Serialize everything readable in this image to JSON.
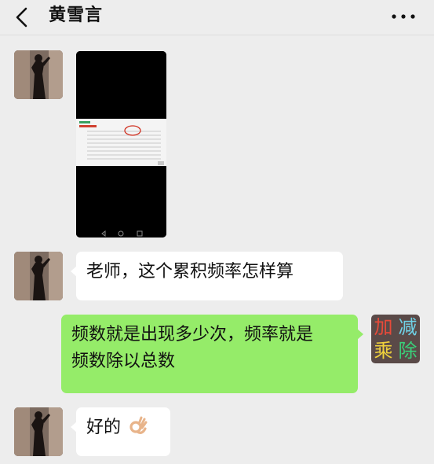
{
  "header": {
    "back_icon": "chevron-left-icon",
    "title": "黄雪言",
    "more_icon": "more-dots-icon"
  },
  "messages": [
    {
      "sender": "黄雪言",
      "type": "image",
      "content": ""
    },
    {
      "sender": "黄雪言",
      "type": "text",
      "text": "老师，这个累积频率怎样算"
    },
    {
      "sender": "me",
      "type": "text",
      "line1": "频数就是出现多少次，频率就是",
      "line2": "频数除以总数"
    },
    {
      "sender": "黄雪言",
      "type": "text",
      "text": "好的",
      "emoji": "ok-hand-icon"
    }
  ],
  "my_avatar": {
    "chars": [
      "加",
      "减",
      "乘",
      "除"
    ],
    "colors": [
      "#e84a3a",
      "#6fd3e8",
      "#f0d23c",
      "#3ad07a"
    ]
  },
  "colors": {
    "background": "#ededed",
    "bubble_left": "#ffffff",
    "bubble_right": "#95ec69"
  }
}
